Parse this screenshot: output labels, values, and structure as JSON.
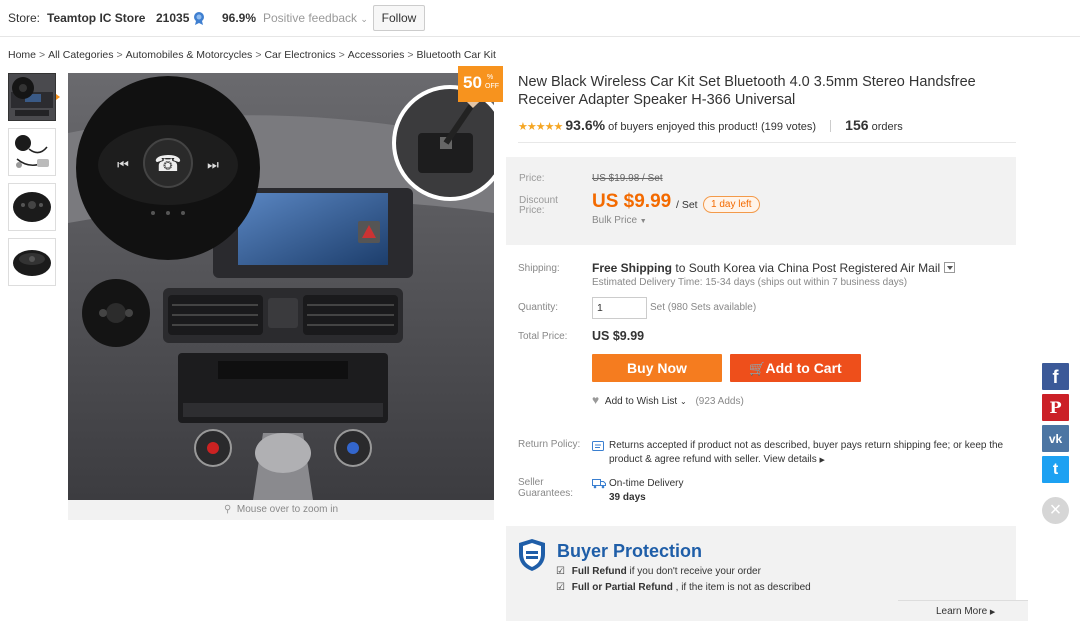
{
  "store_bar": {
    "store_label": "Store:",
    "store_name": "Teamtop IC Store",
    "score": "21035",
    "feedback_percent": "96.9%",
    "feedback_label": "Positive feedback",
    "follow_label": "Follow"
  },
  "breadcrumb": [
    "Home",
    "All Categories",
    "Automobiles & Motorcycles",
    "Car Electronics",
    "Accessories",
    "Bluetooth Car Kit"
  ],
  "gallery": {
    "thumbnails": [
      "car-kit-in-car",
      "car-kit-accessories",
      "car-kit-front",
      "car-kit-angle"
    ],
    "discount_badge": {
      "percent": "50",
      "pct_sign": "%",
      "off": "OFF"
    },
    "zoom_hint": "Mouse over to zoom in"
  },
  "product": {
    "title": "New Black Wireless Car Kit Set Bluetooth 4.0 3.5mm Stereo Handsfree Receiver Adapter Speaker H-366 Universal",
    "stars": "★★★★★",
    "rating_percent": "93.6%",
    "rating_text": "of buyers enjoyed this product!",
    "votes": "(199 votes)",
    "orders_count": "156",
    "orders_label": "orders"
  },
  "price": {
    "price_label": "Price:",
    "old_price": "US $19.98 / Set",
    "discount_label_1": "Discount",
    "discount_label_2": "Price:",
    "discount_price": "US $9.99",
    "unit": "/ Set",
    "days_left": "1 day left",
    "bulk_price": "Bulk Price"
  },
  "shipping": {
    "label": "Shipping:",
    "free": "Free Shipping",
    "to": "to",
    "destination": "South Korea via China Post Registered Air Mail",
    "estimate": "Estimated Delivery Time: 15-34 days (ships out within 7 business days)"
  },
  "quantity": {
    "label": "Quantity:",
    "value": "1",
    "available": "Set (980 Sets available)"
  },
  "total": {
    "label": "Total Price:",
    "value": "US $9.99"
  },
  "actions": {
    "buy_now": "Buy Now",
    "add_to_cart": "Add to Cart",
    "wish_list": "Add to Wish List",
    "wish_count": "(923 Adds)"
  },
  "return_policy": {
    "label": "Return Policy:",
    "text": "Returns accepted if product not as described, buyer pays return shipping fee; or keep the product & agree refund with seller.",
    "view_details": "View details"
  },
  "seller_guarantees": {
    "label_1": "Seller",
    "label_2": "Guarantees:",
    "on_time": "On-time Delivery",
    "days": "39 days"
  },
  "buyer_protection": {
    "title": "Buyer Protection",
    "full_refund": "Full Refund",
    "full_refund_text": "if you don't receive your order",
    "partial_refund": "Full or Partial Refund",
    "partial_refund_text": ", if the item is not as described",
    "learn_more": "Learn More"
  },
  "social": {
    "facebook": "f",
    "pinterest": "P",
    "vk": "vk",
    "twitter": "t",
    "close": "×"
  },
  "colors": {
    "orange": "#f57c1f",
    "cart_red": "#ee4f1b",
    "price_orange": "#f36a00",
    "bp_blue": "#1f5ea8"
  }
}
